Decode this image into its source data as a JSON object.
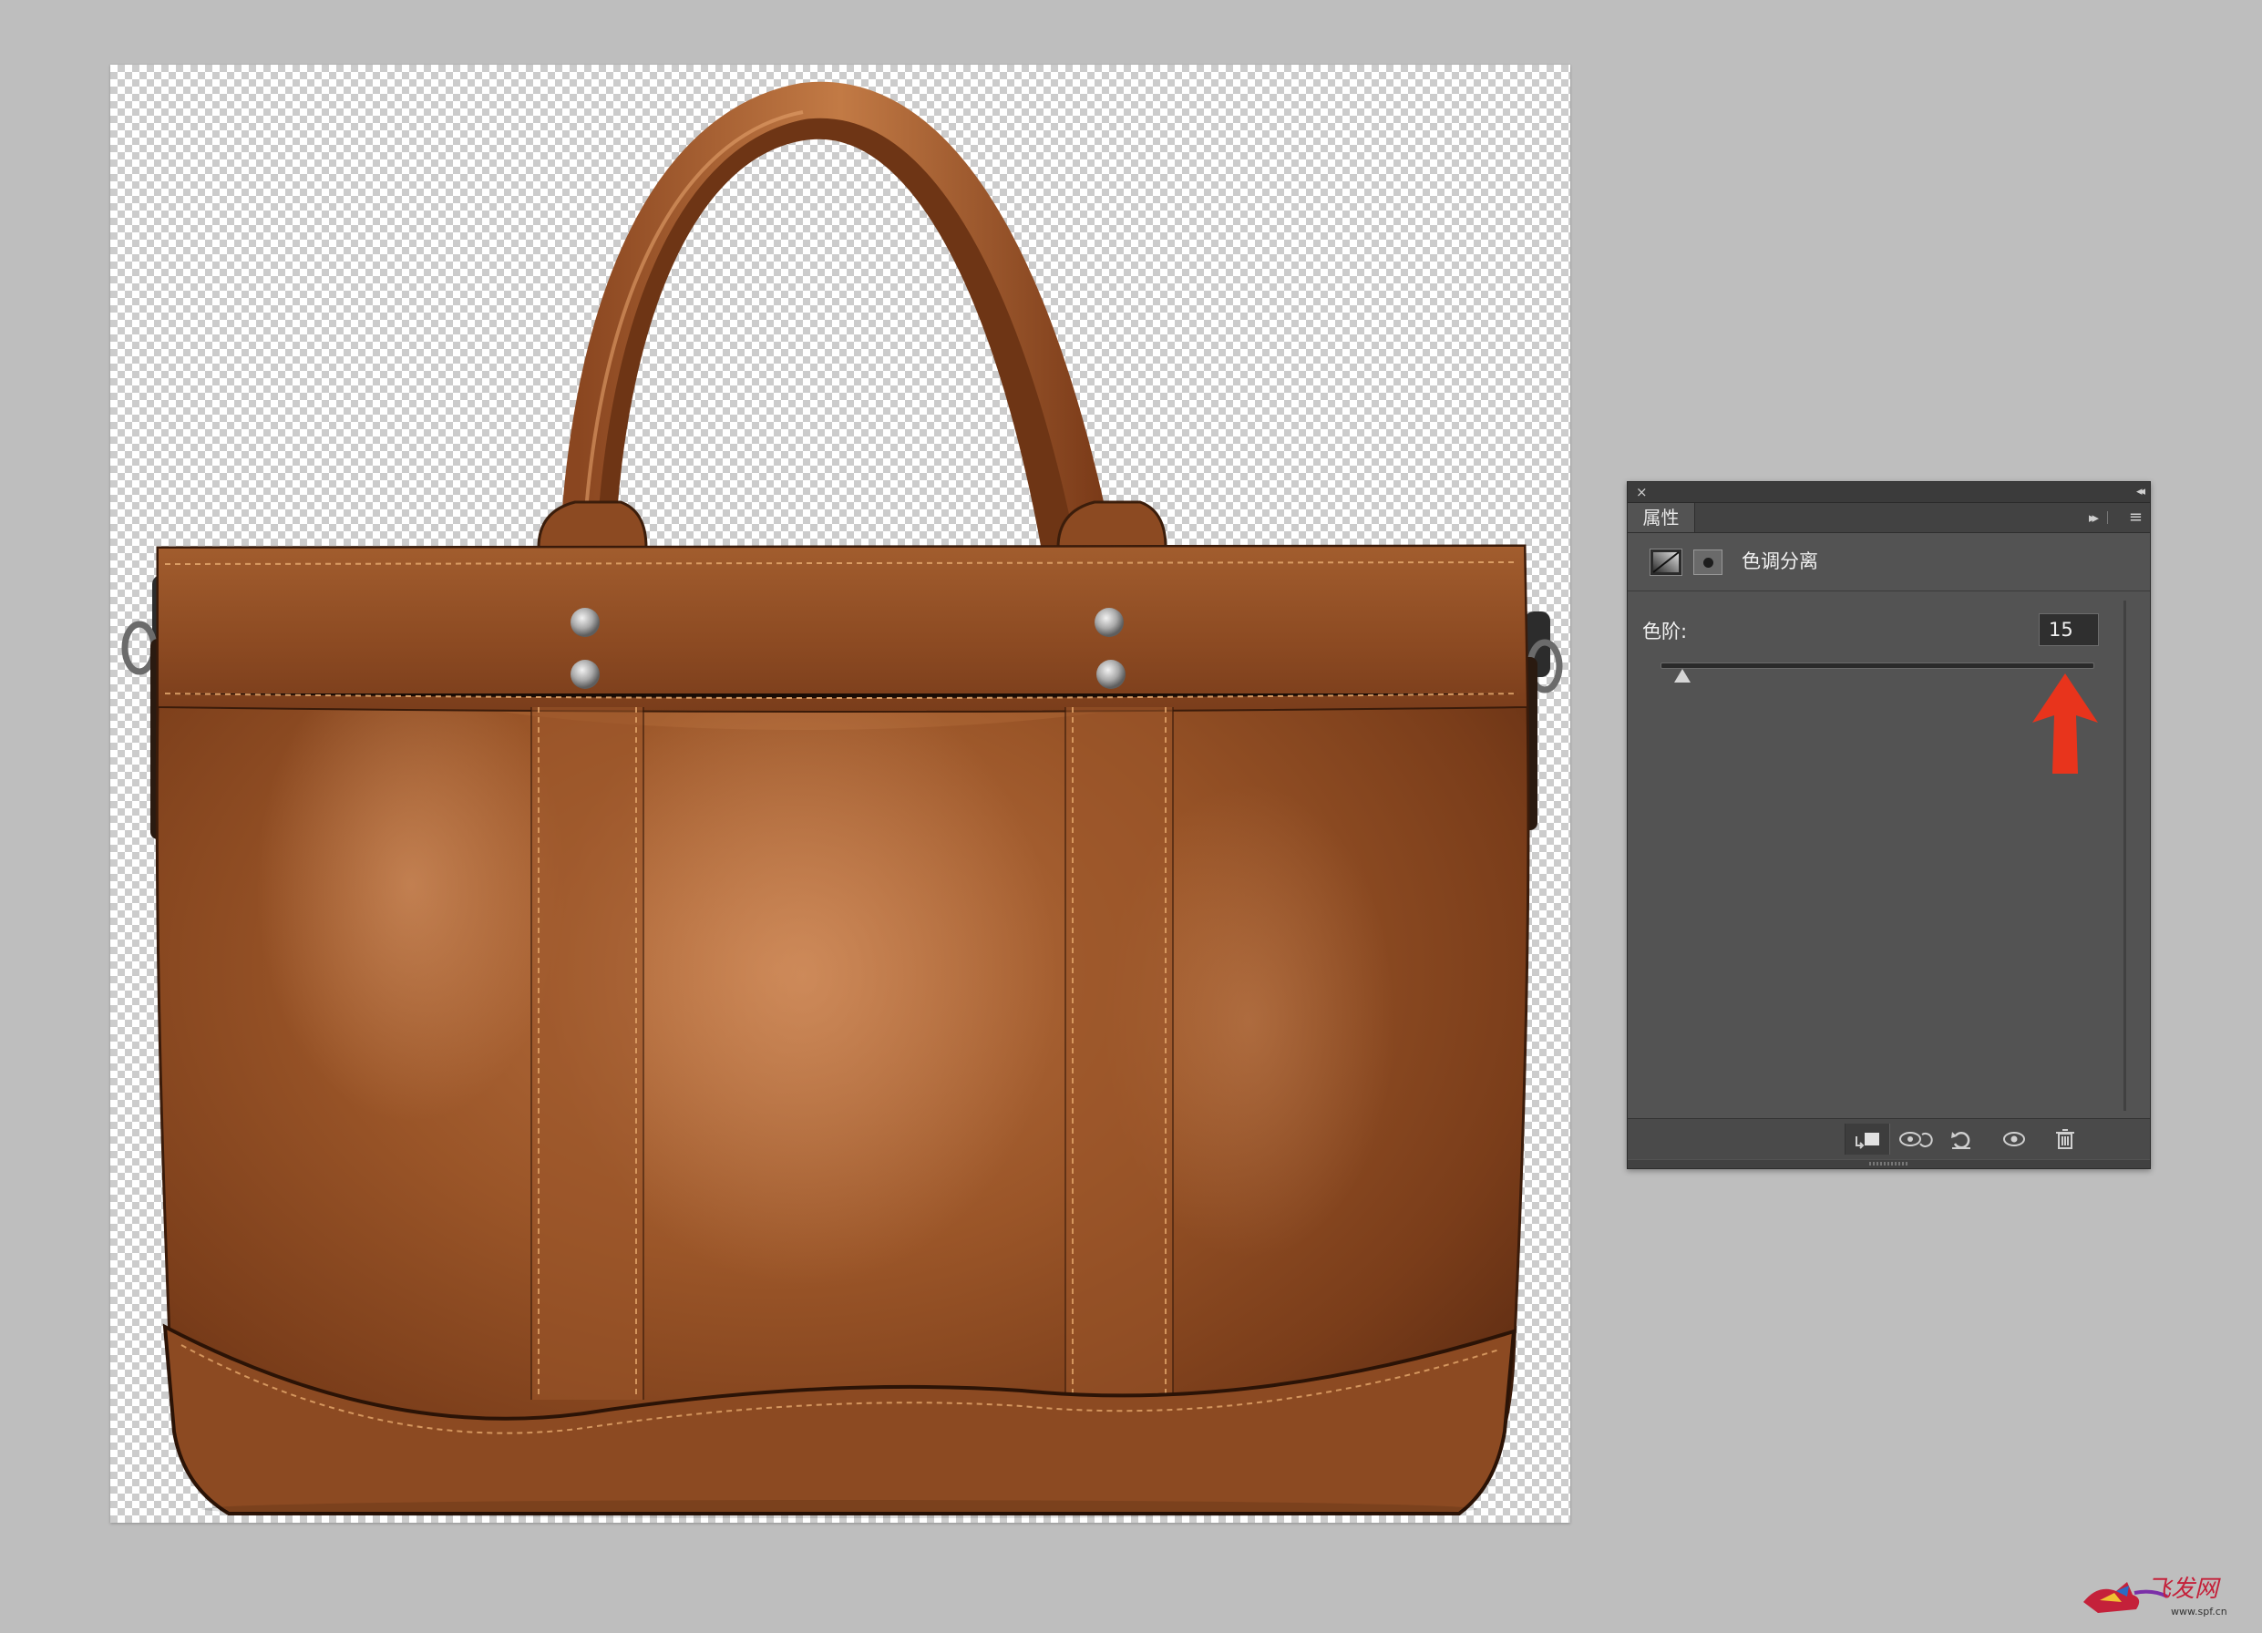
{
  "panel": {
    "close_glyph": "×",
    "collapse_glyph": "◂◂",
    "tab_label": "属性",
    "tab_expand_glyph": "▸▸",
    "tab_menu_glyph": "≡",
    "adjustment_title": "色调分离",
    "levels_label": "色阶:",
    "levels_value": "15",
    "levels_slider_fraction": 0.05
  },
  "footer_icons": [
    "clip-to-layer-icon",
    "view-previous-state-icon",
    "reset-icon",
    "visibility-icon",
    "trash-icon"
  ],
  "colors": {
    "app_background": "#bebebe",
    "panel_background": "#535353",
    "annotation_arrow": "#e8341c",
    "leather": "#8a4a22"
  },
  "watermark": {
    "logo_text": "飞发网",
    "url": "www.spf.cn"
  }
}
